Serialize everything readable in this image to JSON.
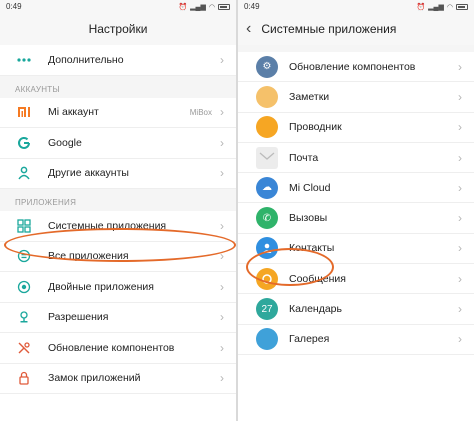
{
  "left": {
    "time": "0:49",
    "title": "Настройки",
    "items_top": [
      {
        "label": "Дополнительно",
        "icon": "more-dots-icon"
      }
    ],
    "section_accounts": "АККАУНТЫ",
    "accounts": [
      {
        "label": "Mi аккаунт",
        "value": "MiBox",
        "icon": "mi-logo-icon"
      },
      {
        "label": "Google",
        "icon": "google-icon"
      },
      {
        "label": "Другие аккаунты",
        "icon": "person-icon"
      }
    ],
    "section_apps": "ПРИЛОЖЕНИЯ",
    "apps": [
      {
        "label": "Системные приложения",
        "icon": "grid-icon"
      },
      {
        "label": "Все приложения",
        "icon": "apps-circle-icon"
      },
      {
        "label": "Двойные приложения",
        "icon": "dual-apps-icon"
      },
      {
        "label": "Разрешения",
        "icon": "shield-icon"
      },
      {
        "label": "Обновление компонентов",
        "icon": "update-icon"
      },
      {
        "label": "Замок приложений",
        "icon": "lock-icon"
      }
    ]
  },
  "right": {
    "time": "0:49",
    "title": "Системные приложения",
    "items": [
      {
        "label": "Обновление компонентов",
        "icon": "gear-icon",
        "color": "#5b7fa8"
      },
      {
        "label": "Заметки",
        "icon": "notes-icon",
        "color": "#f5b74a"
      },
      {
        "label": "Проводник",
        "icon": "folder-icon",
        "color": "#f6a623"
      },
      {
        "label": "Почта",
        "icon": "mail-icon",
        "color": "#e6e6e6"
      },
      {
        "label": "Mi Cloud",
        "icon": "cloud-icon",
        "color": "#3a86d6"
      },
      {
        "label": "Вызовы",
        "icon": "phone-icon",
        "color": "#2fb36a"
      },
      {
        "label": "Контакты",
        "icon": "contacts-icon",
        "color": "#2f8fe0"
      },
      {
        "label": "Сообщения",
        "icon": "messages-icon",
        "color": "#f5a623"
      },
      {
        "label": "Календарь",
        "icon": "calendar-icon",
        "color": "#2fa89c"
      },
      {
        "label": "Галерея",
        "icon": "gallery-icon",
        "color": "#3fa1d9"
      }
    ]
  }
}
